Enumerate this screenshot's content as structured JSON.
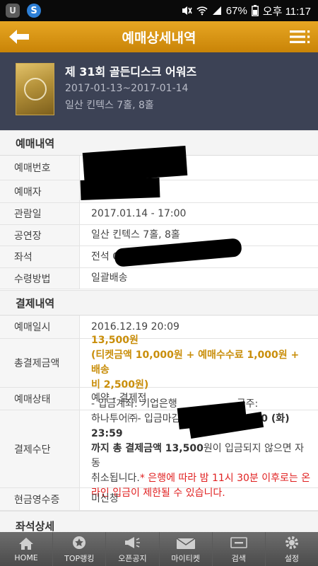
{
  "status_bar": {
    "battery": "67%",
    "time": "오후 11:17",
    "app_icon_label": "U",
    "second_icon_label": "S"
  },
  "header": {
    "title": "예매상세내역"
  },
  "event": {
    "title": "제 31회 골든디스크 어워즈",
    "dates": "2017-01-13~2017-01-14",
    "venue": "일산 킨텍스 7홀, 8홀"
  },
  "booking": {
    "title": "예매내역",
    "rows": [
      {
        "label": "예매번호",
        "value": ""
      },
      {
        "label": "예매자",
        "value": ""
      },
      {
        "label": "관람일",
        "value": "2017.01.14 - 17:00"
      },
      {
        "label": "공연장",
        "value": "일산 킨텍스 7홀, 8홀"
      },
      {
        "label": "좌석",
        "value": "전석 G"
      },
      {
        "label": "수령방법",
        "value": "일괄배송"
      }
    ]
  },
  "payment": {
    "title": "결제내역",
    "date_label": "예매일시",
    "date_value": "2016.12.19 20:09",
    "total_label": "총결제금액",
    "total_value": "13,500원",
    "total_detail_1": "(티켓금액 10,000원 + 예매수수료 1,000원 + 배송",
    "total_detail_2": "비 2,500원)",
    "status_label": "예매상태",
    "status_value": "예약 - 결제전",
    "method_label": "결제수단",
    "method_line1": "- 입금계좌: 기업은행",
    "method_line1_tail": "금주:",
    "method_line2_a": "하나투어㈜- 입금마감시간: ",
    "method_line2_b": "2016.12.20 (화) 23:59",
    "method_line3_a": "까지 총 결제금액 ",
    "method_line3_b": "13,500",
    "method_line3_c": "원이 입금되지 않으면 자동",
    "method_line4_a": "취소됩니다.",
    "method_line4_b": "* 은행에 따라 밤 11시 30분 이후로는 온",
    "method_line5": "라인 입금이 제한될 수 있습니다.",
    "receipt_label": "현금영수증",
    "receipt_value": "미신청"
  },
  "next_section": {
    "title": "좌석상세"
  },
  "bottom_nav": [
    {
      "label": "HOME"
    },
    {
      "label": "TOP랭킹"
    },
    {
      "label": "오픈공지"
    },
    {
      "label": "마이티켓",
      "badge": "MY"
    },
    {
      "label": "검색"
    },
    {
      "label": "설정"
    }
  ]
}
